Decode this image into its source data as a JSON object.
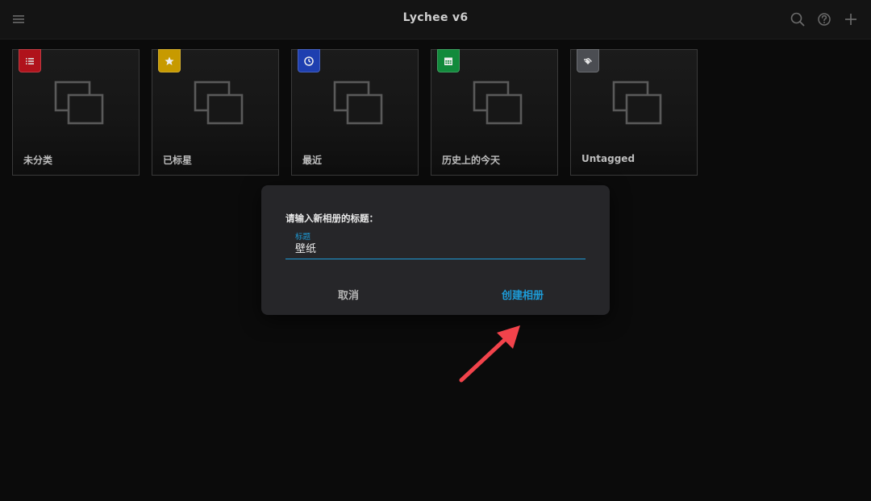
{
  "header": {
    "title": "Lychee v6",
    "left_icon": "menu-icon",
    "right_icons": [
      "search-icon",
      "help-icon",
      "plus-icon"
    ]
  },
  "albums": [
    {
      "label": "未分类",
      "badge_icon": "list-icon",
      "badge_color": "#b0121b"
    },
    {
      "label": "已标星",
      "badge_icon": "star-icon",
      "badge_color": "#c79a00"
    },
    {
      "label": "最近",
      "badge_icon": "clock-icon",
      "badge_color": "#1e3fb0"
    },
    {
      "label": "历史上的今天",
      "badge_icon": "calendar-icon",
      "badge_color": "#128a3c"
    },
    {
      "label": "Untagged",
      "badge_icon": "tags-icon",
      "badge_color": "#4b4d52"
    }
  ],
  "dialog": {
    "prompt": "请输入新相册的标题：",
    "field_label": "标题",
    "field_value": "壁纸",
    "cancel_label": "取消",
    "create_label": "创建相册",
    "accent_color": "#1d9bd7"
  },
  "annotation": {
    "arrow_color": "#f2434b",
    "icon": "arrow-icon"
  }
}
